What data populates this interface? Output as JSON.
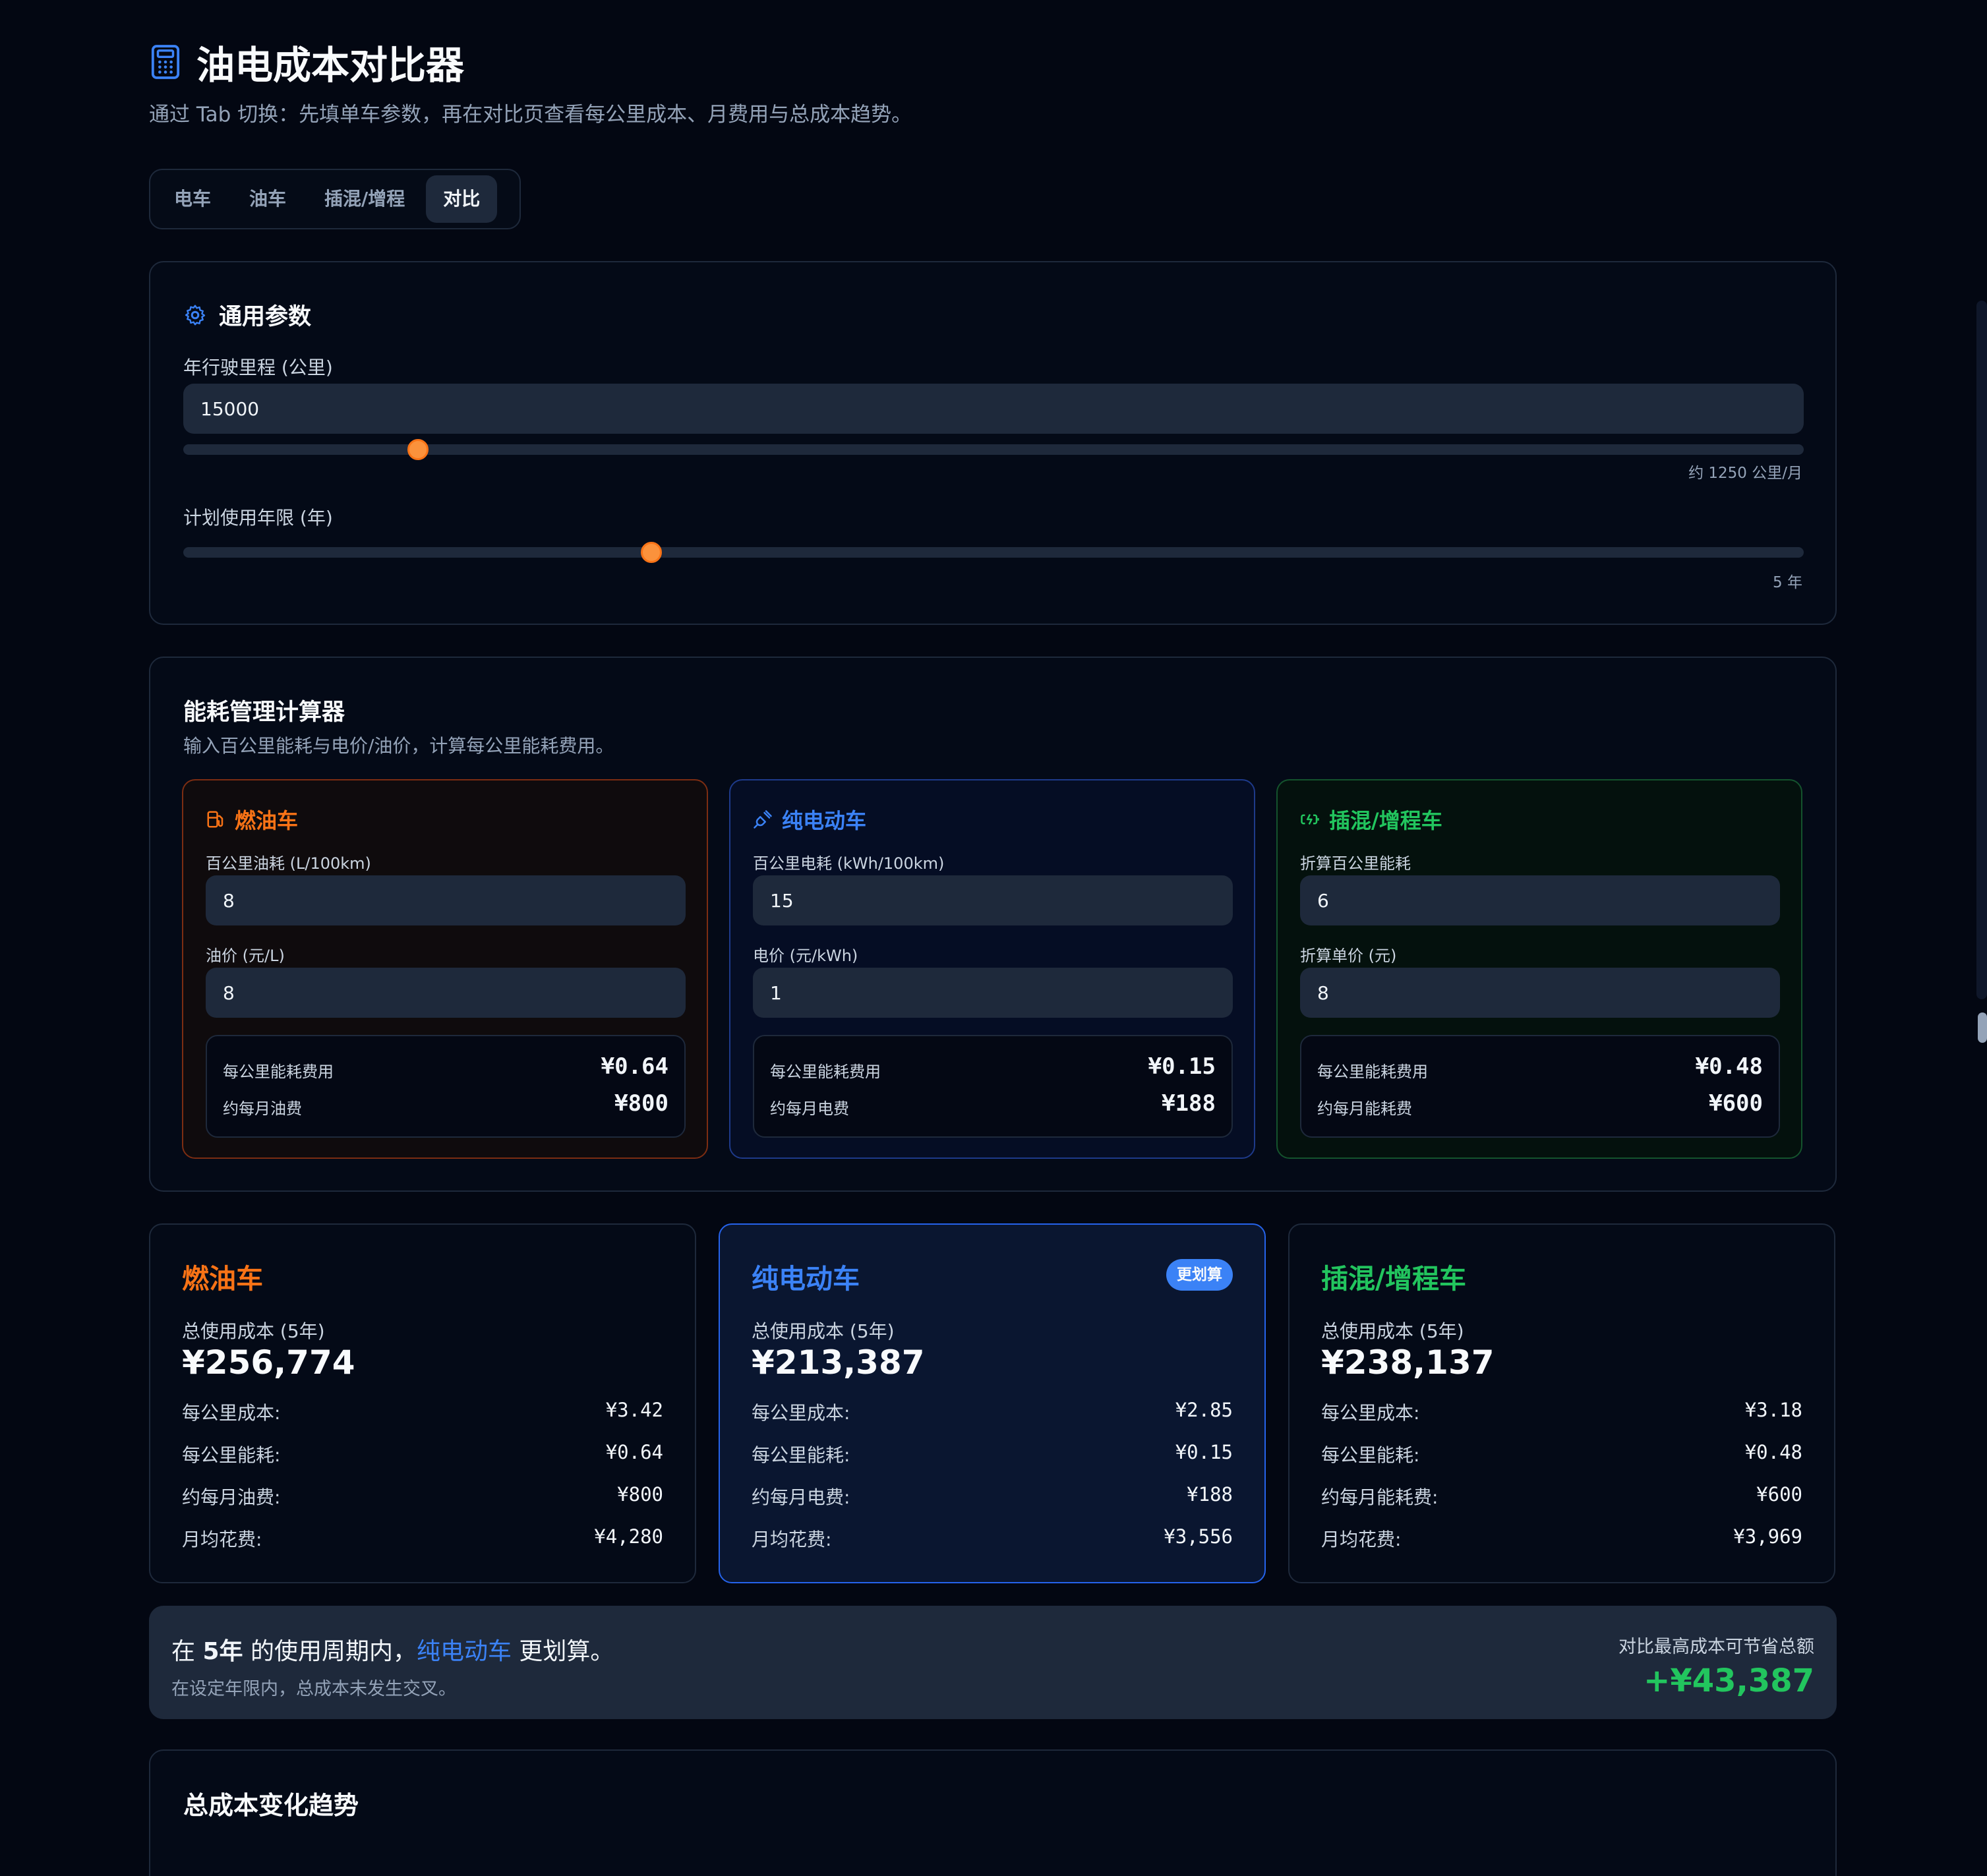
{
  "header": {
    "title": "油电成本对比器",
    "subtitle": "通过 Tab 切换：先填单车参数，再在对比页查看每公里成本、月费用与总成本趋势。"
  },
  "tabs": [
    {
      "label": "电车",
      "active": false
    },
    {
      "label": "油车",
      "active": false
    },
    {
      "label": "插混/增程",
      "active": false
    },
    {
      "label": "对比",
      "active": true
    }
  ],
  "general": {
    "title": "通用参数",
    "mileage_label": "年行驶里程 (公里)",
    "mileage_value": "15000",
    "mileage_slider_fraction": 0.145,
    "mileage_note": "约 1250 公里/月",
    "years_label": "计划使用年限 (年)",
    "years_slider_fraction": 0.289,
    "years_note": "5 年"
  },
  "energy": {
    "title": "能耗管理计算器",
    "subtitle": "输入百公里能耗与电价/油价，计算每公里能耗费用。",
    "oil": {
      "name": "燃油车",
      "icon": "fuel-pump-icon",
      "field1_label": "百公里油耗 (L/100km)",
      "field1_value": "8",
      "field2_label": "油价 (元/L)",
      "field2_value": "8",
      "per_km_label": "每公里能耗费用",
      "per_km_value": "¥0.64",
      "monthly_label": "约每月油费",
      "monthly_value": "¥800"
    },
    "ev": {
      "name": "纯电动车",
      "icon": "plug-icon",
      "field1_label": "百公里电耗 (kWh/100km)",
      "field1_value": "15",
      "field2_label": "电价 (元/kWh)",
      "field2_value": "1",
      "per_km_label": "每公里能耗费用",
      "per_km_value": "¥0.15",
      "monthly_label": "约每月电费",
      "monthly_value": "¥188"
    },
    "phev": {
      "name": "插混/增程车",
      "icon": "battery-charging-icon",
      "field1_label": "折算百公里能耗",
      "field1_value": "6",
      "field2_label": "折算单价 (元)",
      "field2_value": "8",
      "per_km_label": "每公里能耗费用",
      "per_km_value": "¥0.48",
      "monthly_label": "约每月能耗费",
      "monthly_value": "¥600"
    }
  },
  "summary": {
    "oil": {
      "name": "燃油车",
      "total_label": "总使用成本 (5年)",
      "total_value": "¥256,774",
      "rows": [
        {
          "label": "每公里成本:",
          "value": "¥3.42"
        },
        {
          "label": "每公里能耗:",
          "value": "¥0.64"
        },
        {
          "label": "约每月油费:",
          "value": "¥800"
        },
        {
          "label": "月均花费:",
          "value": "¥4,280"
        }
      ]
    },
    "ev": {
      "name": "纯电动车",
      "badge": "更划算",
      "total_label": "总使用成本 (5年)",
      "total_value": "¥213,387",
      "rows": [
        {
          "label": "每公里成本:",
          "value": "¥2.85"
        },
        {
          "label": "每公里能耗:",
          "value": "¥0.15"
        },
        {
          "label": "约每月电费:",
          "value": "¥188"
        },
        {
          "label": "月均花费:",
          "value": "¥3,556"
        }
      ]
    },
    "phev": {
      "name": "插混/增程车",
      "total_label": "总使用成本 (5年)",
      "total_value": "¥238,137",
      "rows": [
        {
          "label": "每公里成本:",
          "value": "¥3.18"
        },
        {
          "label": "每公里能耗:",
          "value": "¥0.48"
        },
        {
          "label": "约每月能耗费:",
          "value": "¥600"
        },
        {
          "label": "月均花费:",
          "value": "¥3,969"
        }
      ]
    }
  },
  "conclusion": {
    "prefix": "在 ",
    "years": "5年",
    "middle": " 的使用周期内，",
    "winner": "纯电动车",
    "suffix": " 更划算。",
    "sub": "在设定年限内，总成本未发生交叉。",
    "savings_label": "对比最高成本可节省总额",
    "savings_value": "+¥43,387"
  },
  "trend": {
    "title": "总成本变化趋势"
  },
  "colors": {
    "oil": "#f97316",
    "ev": "#3b82f6",
    "phev": "#22c55e",
    "slider": "#fb923c"
  }
}
